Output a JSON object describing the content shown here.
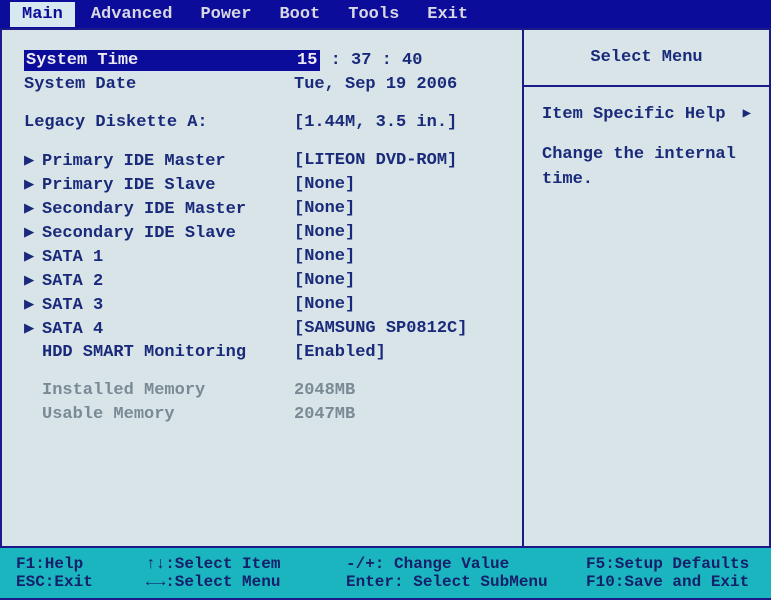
{
  "menu": {
    "items": [
      "Main",
      "Advanced",
      "Power",
      "Boot",
      "Tools",
      "Exit"
    ],
    "activeIndex": 0
  },
  "main": {
    "systemTime": {
      "label": "System Time",
      "hh": "15",
      "mm": "37",
      "ss": "40"
    },
    "systemDate": {
      "label": "System Date",
      "value": "Tue, Sep 19 2006"
    },
    "legacyDisketteA": {
      "label": "Legacy Diskette A:",
      "value": "[1.44M, 3.5 in.]"
    },
    "submenus": [
      {
        "label": "Primary IDE Master",
        "value": "[LITEON  DVD-ROM]"
      },
      {
        "label": "Primary IDE Slave",
        "value": "[None]"
      },
      {
        "label": "Secondary IDE Master",
        "value": "[None]"
      },
      {
        "label": "Secondary IDE Slave",
        "value": "[None]"
      },
      {
        "label": "SATA 1",
        "value": "[None]"
      },
      {
        "label": "SATA 2",
        "value": "[None]"
      },
      {
        "label": "SATA 3",
        "value": "[None]"
      },
      {
        "label": "SATA 4",
        "value": "[SAMSUNG SP0812C]"
      }
    ],
    "hddSmart": {
      "label": "HDD SMART Monitoring",
      "value": "[Enabled]"
    },
    "installedMemory": {
      "label": "Installed Memory",
      "value": "2048MB"
    },
    "usableMemory": {
      "label": "Usable Memory",
      "value": "2047MB"
    }
  },
  "help": {
    "title": "Select Menu",
    "heading": "Item Specific Help",
    "text": "Change the internal time."
  },
  "footer": {
    "f1": "F1:Help",
    "updown": "↑↓:Select Item",
    "plusminus": "-/+: Change Value",
    "f5": "F5:Setup Defaults",
    "esc": "ESC:Exit",
    "leftright": "←→:Select Menu",
    "enter": "Enter: Select SubMenu",
    "f10": "F10:Save and Exit"
  }
}
